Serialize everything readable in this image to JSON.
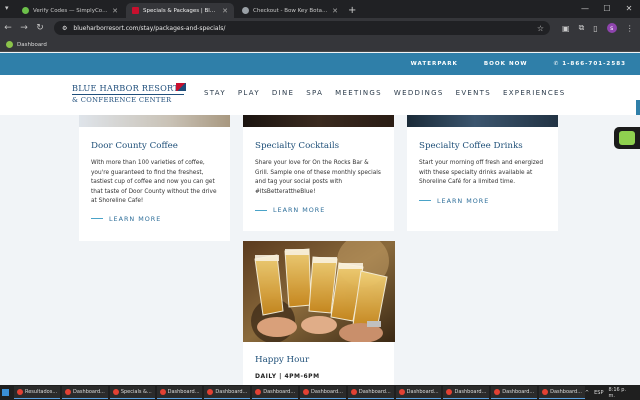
{
  "browser": {
    "tabs": [
      {
        "title": "Verify Codes — SimplyCodes",
        "color": "#6cc04a",
        "active": false
      },
      {
        "title": "Specials & Packages | Blue Harb",
        "color": "#c8102e",
        "active": true
      },
      {
        "title": "Checkout - Bow Key Botanicals",
        "color": "#9aa0a6",
        "active": false
      }
    ],
    "url": "blueharborresort.com/stay/packages-and-specials/",
    "bookmark": "Dashboard",
    "profile_initial": "s"
  },
  "topbar": {
    "links": [
      "WATERPARK",
      "BOOK NOW"
    ],
    "phone": "1-866-701-2583"
  },
  "logo": {
    "line1": "BLUE HARBOR RESORT",
    "line2": "& CONFERENCE CENTER"
  },
  "nav": [
    "STAY",
    "PLAY",
    "DINE",
    "SPA",
    "MEETINGS",
    "WEDDINGS",
    "EVENTS",
    "EXPERIENCES"
  ],
  "cards": [
    {
      "title": "Door County Coffee",
      "text": "With more than 100 varieties of coffee, you're guaranteed to find the freshest, tastiest cup of coffee and now you can get that taste of Door County without the drive at Shoreline Cafe!",
      "cta": "LEARN MORE"
    },
    {
      "title": "Specialty Cocktails",
      "text": "Share your love for On the Rocks Bar & Grill. Sample one of these monthly specials and tag your social posts with #ItsBetterattheBlue!",
      "cta": "LEARN MORE"
    },
    {
      "title": "Specialty Coffee Drinks",
      "text": "Start your morning off fresh and energized with these specialty drinks available at Shoreline Café for a limited time.",
      "cta": "LEARN MORE"
    }
  ],
  "happy_hour": {
    "title": "Happy Hour",
    "schedule": "DAILY | 4PM-6PM"
  },
  "taskbar": {
    "items": [
      "Resultados...",
      "Dashboard...",
      "Specials &...",
      "Dashboard...",
      "Dashboard...",
      "Dashboard...",
      "Dashboard...",
      "Dashboard...",
      "Dashboard...",
      "Dashboard...",
      "Dashboard...",
      "Dashboard..."
    ],
    "lang": "ESP",
    "time": "8:16 p. m."
  }
}
